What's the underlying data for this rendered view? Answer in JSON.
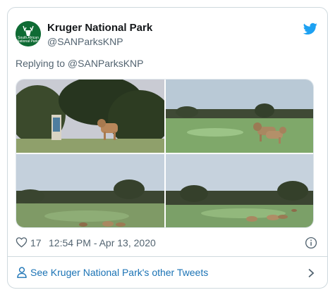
{
  "tweet": {
    "author_name": "Kruger National Park",
    "handle": "@SANParksKNP",
    "avatar_text": "South African National Parks",
    "reply_context": "Replying to @SANParksKNP",
    "likes": "17",
    "timestamp": "12:54 PM - Apr 13, 2020"
  },
  "photos": [
    {
      "subject": "lion-near-signboard"
    },
    {
      "subject": "lions-on-golf-course"
    },
    {
      "subject": "lions-resting-at-dusk"
    },
    {
      "subject": "lions-lying-on-grass"
    }
  ],
  "footer": {
    "link_text": "See Kruger National Park's other Tweets"
  },
  "colors": {
    "twitter_blue": "#1da1f2",
    "link_blue": "#1b73b5",
    "muted_text": "#536471",
    "border": "#cfd9de"
  },
  "icons": [
    "twitter-bird-icon",
    "heart-icon",
    "info-icon",
    "person-icon",
    "chevron-right-icon"
  ]
}
